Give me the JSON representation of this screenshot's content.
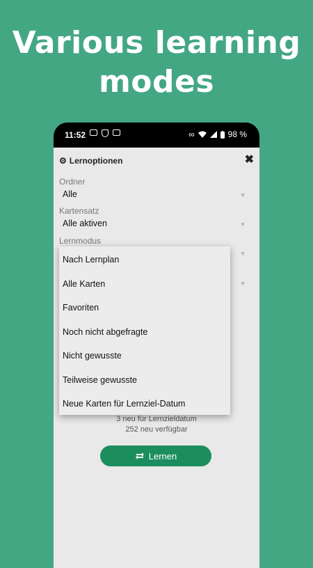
{
  "headline": "Various learning modes",
  "status_bar": {
    "time": "11:52",
    "battery": "98 %"
  },
  "dialog": {
    "title": "Lernoptionen",
    "close": "✖",
    "folder_label": "Ordner",
    "folder_value": "Alle",
    "cardset_label": "Kartensatz",
    "cardset_value": "Alle aktiven",
    "mode_label": "Lernmodus",
    "dropdown_items": [
      "Nach Lernplan",
      "Alle Karten",
      "Favoriten",
      "Noch nicht abgefragte",
      "Nicht gewusste",
      "Teilweise gewusste",
      "Neue Karten für Lernziel-Datum"
    ],
    "info_line1": "3 neu für Lernzieldatum",
    "info_line2": "252 neu verfügbar",
    "learn_button": "Lernen"
  }
}
